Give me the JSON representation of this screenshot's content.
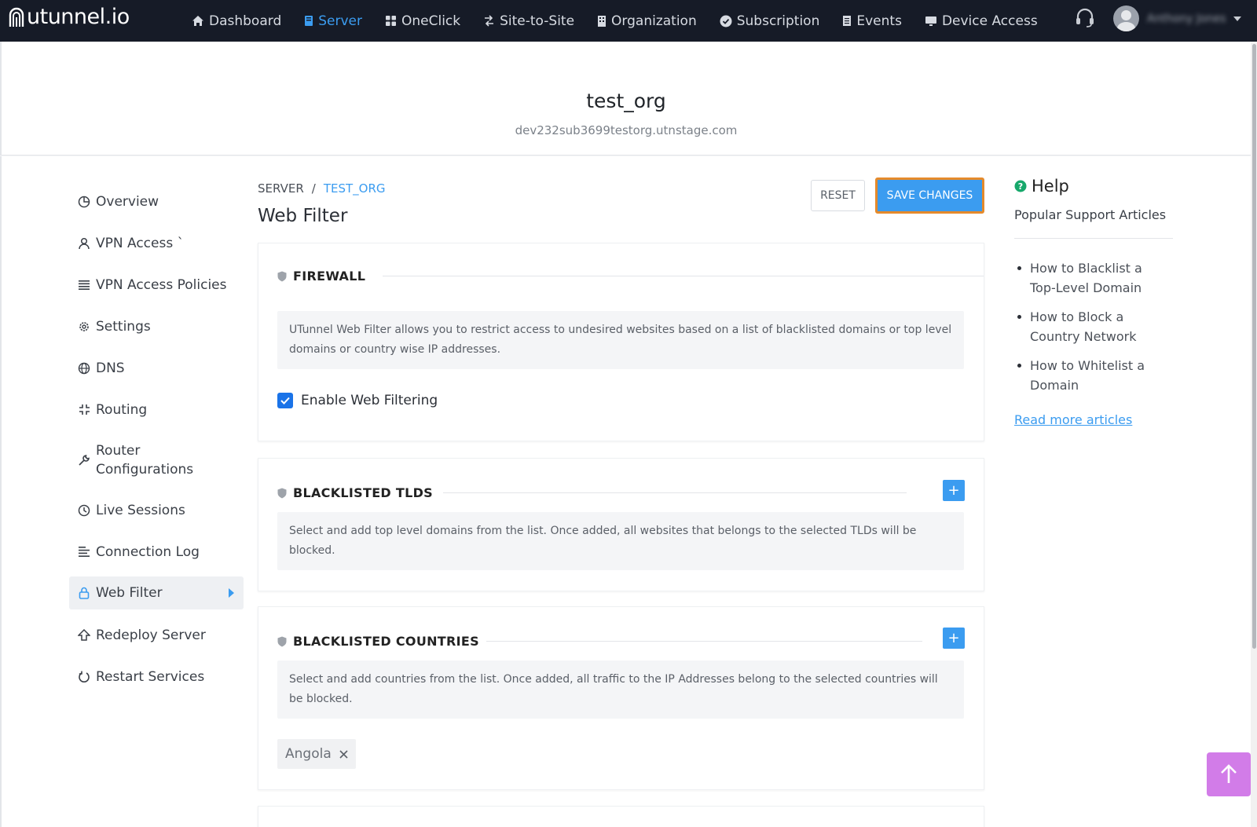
{
  "brand": {
    "name": "utunnel.io"
  },
  "nav": {
    "items": [
      {
        "label": "Dashboard",
        "icon": "home-icon"
      },
      {
        "label": "Server",
        "icon": "server-icon",
        "active": true
      },
      {
        "label": "OneClick",
        "icon": "grid-icon"
      },
      {
        "label": "Site-to-Site",
        "icon": "arrows-icon"
      },
      {
        "label": "Organization",
        "icon": "building-icon"
      },
      {
        "label": "Subscription",
        "icon": "check-circle-icon"
      },
      {
        "label": "Events",
        "icon": "list-icon"
      },
      {
        "label": "Device Access",
        "icon": "monitor-icon"
      }
    ],
    "user_name": "Anthony Jones"
  },
  "org": {
    "name": "test_org",
    "domain": "dev232sub3699testorg.utnstage.com"
  },
  "sidebar": {
    "items": [
      {
        "label": "Overview",
        "icon": "pie-chart-icon"
      },
      {
        "label": "VPN Access `",
        "icon": "user-icon"
      },
      {
        "label": "VPN Access Policies",
        "icon": "list-icon"
      },
      {
        "label": "Settings",
        "icon": "gear-icon"
      },
      {
        "label": "DNS",
        "icon": "globe-icon"
      },
      {
        "label": "Routing",
        "icon": "routing-icon"
      },
      {
        "label": "Router Configurations",
        "icon": "wrench-icon"
      },
      {
        "label": "Live Sessions",
        "icon": "clock-icon"
      },
      {
        "label": "Connection Log",
        "icon": "log-icon"
      },
      {
        "label": "Web Filter",
        "icon": "lock-icon",
        "active": true
      },
      {
        "label": "Redeploy Server",
        "icon": "redeploy-icon"
      },
      {
        "label": "Restart Services",
        "icon": "restart-icon"
      }
    ]
  },
  "breadcrumb": {
    "root": "SERVER",
    "separator": "/",
    "current": "TEST_ORG"
  },
  "page": {
    "title": "Web Filter"
  },
  "actions": {
    "reset": "RESET",
    "save": "SAVE CHANGES"
  },
  "firewall": {
    "title": "FIREWALL",
    "description": "UTunnel Web Filter allows you to restrict access to undesired websites based on a list of blacklisted domains or top level domains or country wise IP addresses.",
    "checkbox_label": "Enable Web Filtering",
    "checked": true
  },
  "tlds": {
    "title": "BLACKLISTED TLDS",
    "add": "+",
    "description": "Select and add top level domains from the list. Once added, all websites that belongs to the selected TLDs will be blocked."
  },
  "countries": {
    "title": "BLACKLISTED COUNTRIES",
    "add": "+",
    "description": "Select and add countries from the list. Once added, all traffic to the IP Addresses belong to the selected countries will be blocked.",
    "tags": [
      "Angola"
    ]
  },
  "help": {
    "title": "Help",
    "subtitle": "Popular Support Articles",
    "articles": [
      "How to Blacklist a Top-Level Domain",
      "How to Block a Country Network",
      "How to Whitelist a Domain"
    ],
    "read_more": "Read more articles"
  },
  "colors": {
    "accent": "#3b9cf0",
    "nav_bg": "#161b27",
    "save_outline": "#e58a2b",
    "to_top": "#d27ce8"
  }
}
